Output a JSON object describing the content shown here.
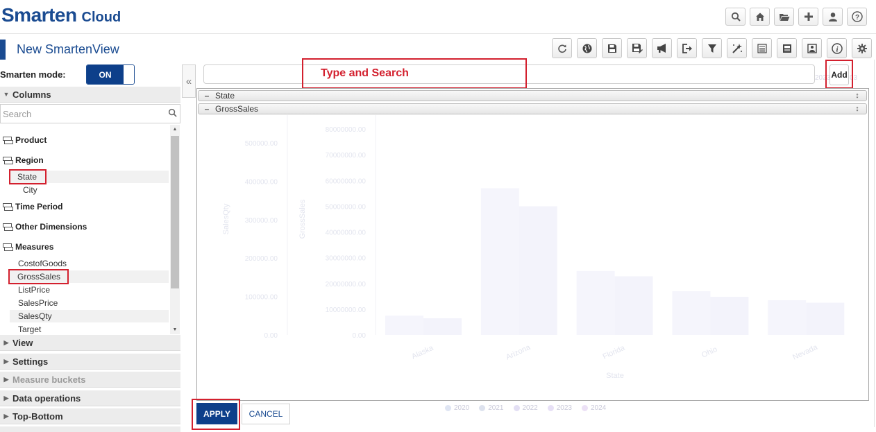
{
  "app": {
    "brand": "Smarten",
    "brand_suffix": "Cloud",
    "view_title": "New SmartenView"
  },
  "header_icons": [
    "search-icon",
    "home-icon",
    "folder-open-icon",
    "plus-icon",
    "user-icon",
    "help-icon"
  ],
  "toolbar_icons": [
    "refresh-icon",
    "globe-icon",
    "save-icon",
    "save-as-icon",
    "megaphone-icon",
    "exit-icon",
    "filter-icon",
    "magic-wand-icon",
    "list-icon",
    "newspaper-icon",
    "image-icon",
    "info-icon",
    "gear-icon"
  ],
  "left": {
    "mode_label": "Smarten mode:",
    "mode_value": "ON",
    "columns_section": "Columns",
    "search_placeholder": "Search",
    "groups": {
      "product": "Product",
      "region": "Region",
      "time_period": "Time Period",
      "other_dimensions": "Other Dimensions",
      "measures": "Measures"
    },
    "region_items": {
      "state": "State",
      "city": "City"
    },
    "measure_items": {
      "cost": "CostofGoods",
      "gross": "GrossSales",
      "list": "ListPrice",
      "sales_price": "SalesPrice",
      "sales_qty": "SalesQty",
      "target": "Target"
    },
    "sections": {
      "view": "View",
      "settings": "Settings",
      "measure_buckets": "Measure buckets",
      "data_operations": "Data operations",
      "top_bottom": "Top-Bottom"
    }
  },
  "main": {
    "search_hint": "Type and Search",
    "add_label": "Add",
    "bucket_state": "State",
    "bucket_gross": "GrossSales",
    "apply_label": "APPLY",
    "cancel_label": "CANCEL"
  },
  "colors": {
    "brand": "#1a4b91",
    "annotation": "#d3202e",
    "apply": "#0d3f8a"
  },
  "chart_data": {
    "type": "bar",
    "faded": true,
    "categories": [
      "Alaska",
      "Arizona",
      "Florida",
      "Ohio",
      "Nevada"
    ],
    "series": [
      {
        "name": "2020",
        "values": [
          7500000,
          57000000,
          24800000,
          17000000,
          13500000
        ]
      },
      {
        "name": "2021",
        "values": [
          6500000,
          50000000,
          22800000,
          14800000,
          12500000
        ]
      }
    ],
    "xlabel": "State",
    "ylabel": "GrossSales",
    "ylim": [
      0,
      80000000
    ],
    "y_ticks": [
      "0.00",
      "10000000.00",
      "20000000.00",
      "30000000.00",
      "40000000.00",
      "50000000.00",
      "60000000.00",
      "70000000.00",
      "80000000.00"
    ],
    "y2_label": "SalesQty",
    "y2_ticks": [
      "0.00",
      "100000.00",
      "200000.00",
      "300000.00",
      "400000.00",
      "500000.00"
    ],
    "legend": [
      "2020",
      "2021",
      "2022",
      "2023",
      "2024"
    ],
    "legend_colors": [
      "#dfe5f3",
      "#dde2ee",
      "#e3dff4",
      "#e7e0f6",
      "#ece1f6"
    ]
  }
}
